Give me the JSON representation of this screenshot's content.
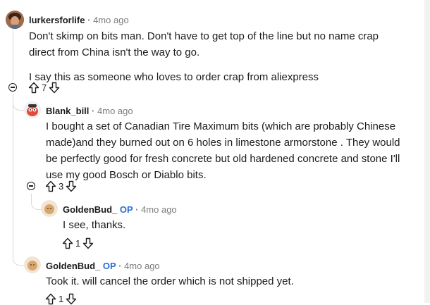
{
  "comments": [
    {
      "id": "c1",
      "username": "lurkersforlife",
      "op_badge": "",
      "separator": "·",
      "time": "4mo ago",
      "paragraphs": [
        "Don't skimp on bits man. Don't have to get top of the line but no name crap direct from China isn't the way to go.",
        "I say this as someone who loves to order crap from aliexpress"
      ],
      "votes": "7"
    },
    {
      "id": "c2",
      "username": "Blank_bill",
      "op_badge": "",
      "separator": "·",
      "time": "4mo ago",
      "paragraphs": [
        "I bought a set of Canadian Tire Maximum bits (which are probably Chinese made)and they burned out on 6 holes in limestone armorstone . They would be perfectly good for fresh concrete but old hardened concrete and stone I'll use my good Bosch or Diablo bits."
      ],
      "votes": "3"
    },
    {
      "id": "c3",
      "username": "GoldenBud_",
      "op_badge": "OP",
      "separator": "·",
      "time": "4mo ago",
      "paragraphs": [
        "I see, thanks."
      ],
      "votes": "1"
    },
    {
      "id": "c4",
      "username": "GoldenBud_",
      "op_badge": "OP",
      "separator": "·",
      "time": "4mo ago",
      "paragraphs": [
        "Took it. will cancel the order which is not shipped yet."
      ],
      "votes": "1"
    }
  ],
  "colors": {
    "op": "#2b6fd6",
    "muted": "#7c7c7c",
    "thread": "#d7dadc"
  }
}
